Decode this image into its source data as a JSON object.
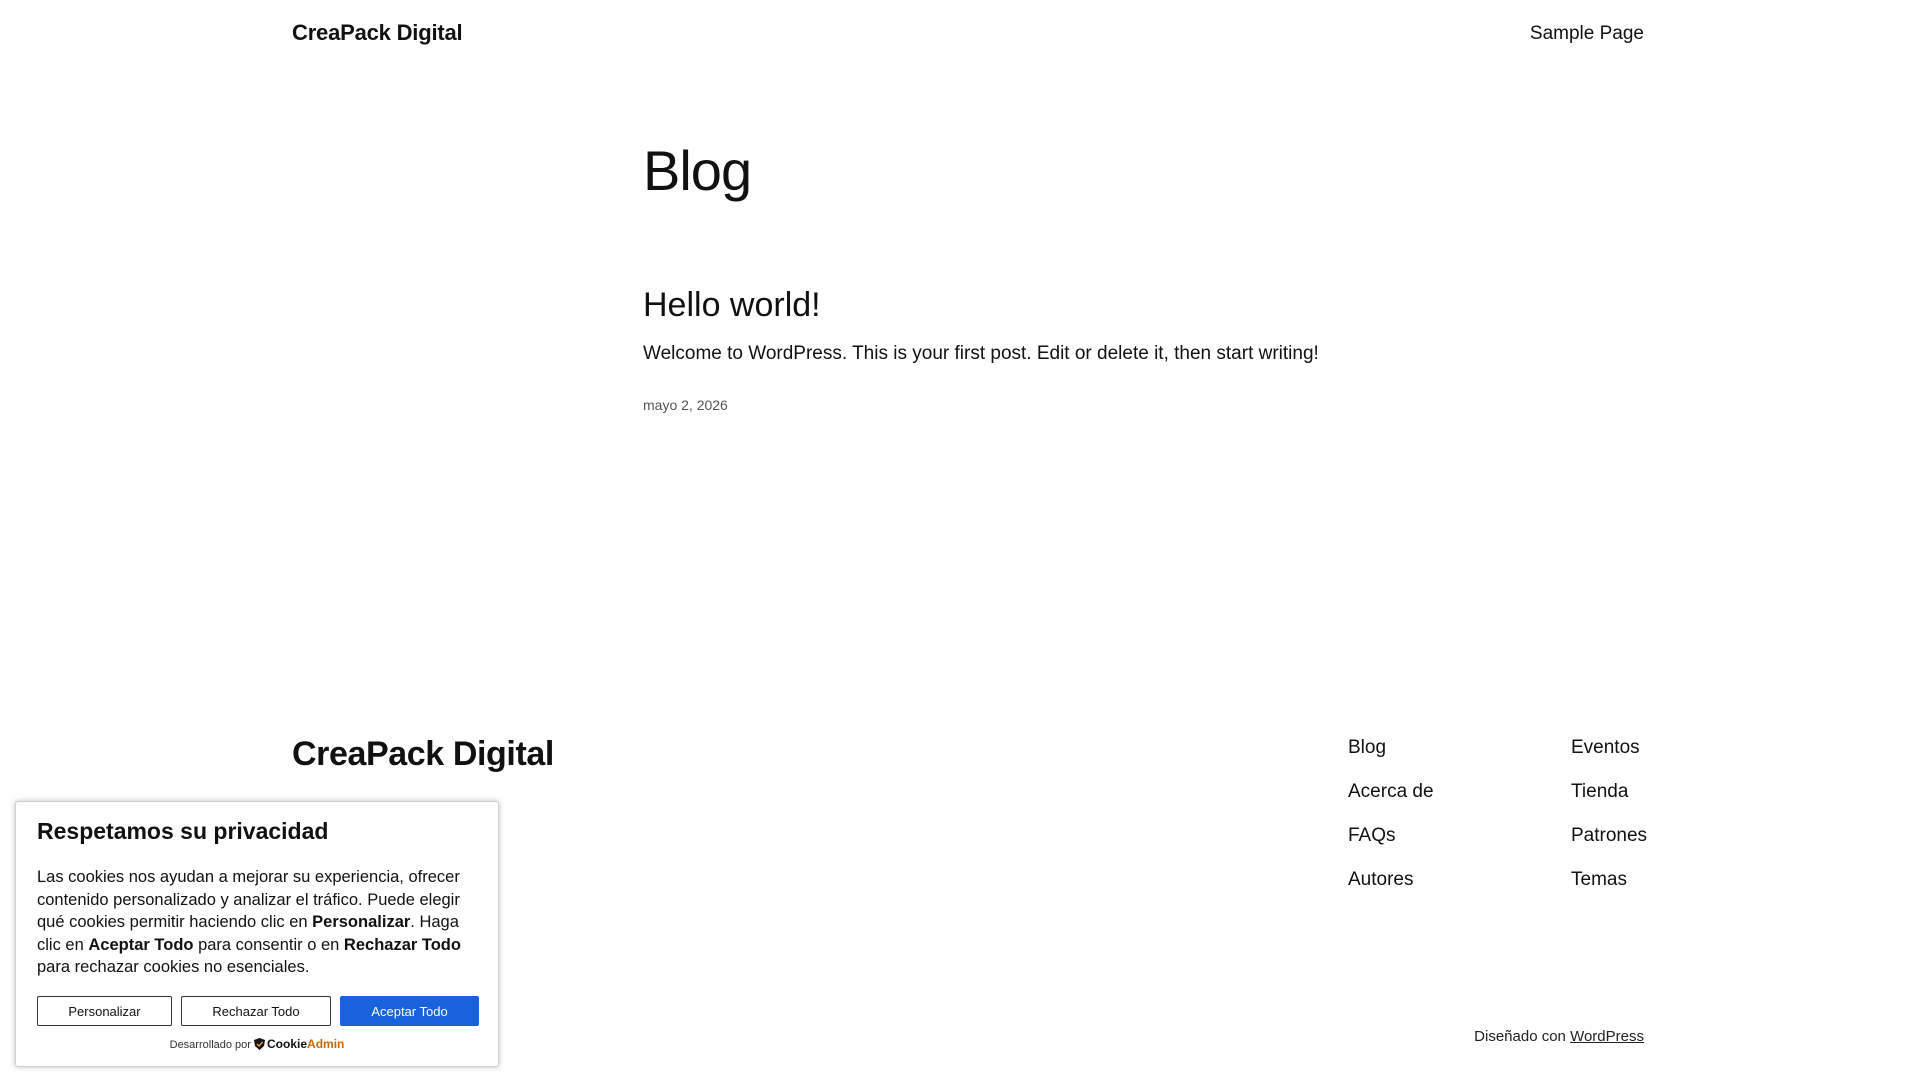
{
  "header": {
    "site_title": "CreaPack Digital",
    "nav": [
      {
        "label": "Sample Page"
      }
    ]
  },
  "main": {
    "page_title": "Blog",
    "posts": [
      {
        "title": "Hello world!",
        "excerpt": "Welcome to WordPress. This is your first post. Edit or delete it, then start writing!",
        "date": "mayo 2, 2026"
      }
    ]
  },
  "footer": {
    "site_title": "CreaPack Digital",
    "nav_col1": [
      {
        "label": "Blog"
      },
      {
        "label": "Acerca de"
      },
      {
        "label": "FAQs"
      },
      {
        "label": "Autores"
      }
    ],
    "nav_col2": [
      {
        "label": "Eventos"
      },
      {
        "label": "Tienda"
      },
      {
        "label": "Patrones"
      },
      {
        "label": "Temas"
      }
    ],
    "credit_prefix": "Diseñado con",
    "credit_link": "WordPress"
  },
  "cookie_banner": {
    "title": "Respetamos su privacidad",
    "text_part1": "Las cookies nos ayudan a mejorar su experiencia, ofrecer contenido personalizado y analizar el tráfico. Puede elegir qué cookies permitir haciendo clic en ",
    "text_bold1": "Personalizar",
    "text_part2": ". Haga clic en ",
    "text_bold2": "Aceptar Todo",
    "text_part3": " para consentir o en ",
    "text_bold3": "Rechazar Todo",
    "text_part4": " para rechazar cookies no esenciales.",
    "btn_customize": "Personalizar",
    "btn_reject": "Rechazar Todo",
    "btn_accept": "Aceptar Todo",
    "powered_by": "Desarrollado por",
    "brand_part1": "Cookie",
    "brand_part2": "Admin",
    "accent_color": "#1863dc"
  }
}
